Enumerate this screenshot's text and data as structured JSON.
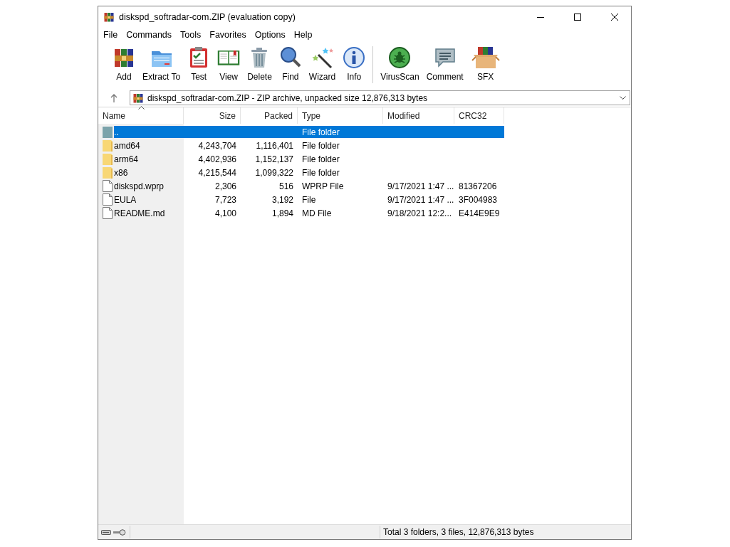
{
  "window": {
    "title": "diskspd_softradar-com.ZIP (evaluation copy)"
  },
  "menu": [
    "File",
    "Commands",
    "Tools",
    "Favorites",
    "Options",
    "Help"
  ],
  "toolbar": [
    {
      "label": "Add",
      "kind": "add"
    },
    {
      "label": "Extract To",
      "kind": "extract"
    },
    {
      "label": "Test",
      "kind": "test"
    },
    {
      "label": "View",
      "kind": "view"
    },
    {
      "label": "Delete",
      "kind": "delete"
    },
    {
      "label": "Find",
      "kind": "find"
    },
    {
      "label": "Wizard",
      "kind": "wizard"
    },
    {
      "label": "Info",
      "kind": "info"
    },
    {
      "label": "VirusScan",
      "kind": "virus"
    },
    {
      "label": "Comment",
      "kind": "comment"
    },
    {
      "label": "SFX",
      "kind": "sfx"
    }
  ],
  "address": {
    "text": "diskspd_softradar-com.ZIP - ZIP archive, unpacked size 12,876,313 bytes"
  },
  "table": {
    "columns": [
      "Name",
      "Size",
      "Packed",
      "Type",
      "Modified",
      "CRC32"
    ],
    "rows": [
      {
        "kind": "parent",
        "name": "..",
        "size": "",
        "packed": "",
        "type": "File folder",
        "modified": "",
        "crc": "",
        "selected": true
      },
      {
        "kind": "folder",
        "name": "amd64",
        "size": "4,243,704",
        "packed": "1,116,401",
        "type": "File folder",
        "modified": "",
        "crc": "",
        "selected": false
      },
      {
        "kind": "folder",
        "name": "arm64",
        "size": "4,402,936",
        "packed": "1,152,137",
        "type": "File folder",
        "modified": "",
        "crc": "",
        "selected": false
      },
      {
        "kind": "folder",
        "name": "x86",
        "size": "4,215,544",
        "packed": "1,099,322",
        "type": "File folder",
        "modified": "",
        "crc": "",
        "selected": false
      },
      {
        "kind": "file",
        "name": "diskspd.wprp",
        "size": "2,306",
        "packed": "516",
        "type": "WPRP File",
        "modified": "9/17/2021 1:47 ...",
        "crc": "81367206",
        "selected": false
      },
      {
        "kind": "file",
        "name": "EULA",
        "size": "7,723",
        "packed": "3,192",
        "type": "File",
        "modified": "9/17/2021 1:47 ...",
        "crc": "3F004983",
        "selected": false
      },
      {
        "kind": "file",
        "name": "README.md",
        "size": "4,100",
        "packed": "1,894",
        "type": "MD File",
        "modified": "9/18/2021 12:2...",
        "crc": "E414E9E9",
        "selected": false
      }
    ]
  },
  "status_bar": {
    "text": "Total 3 folders, 3 files, 12,876,313 bytes"
  }
}
